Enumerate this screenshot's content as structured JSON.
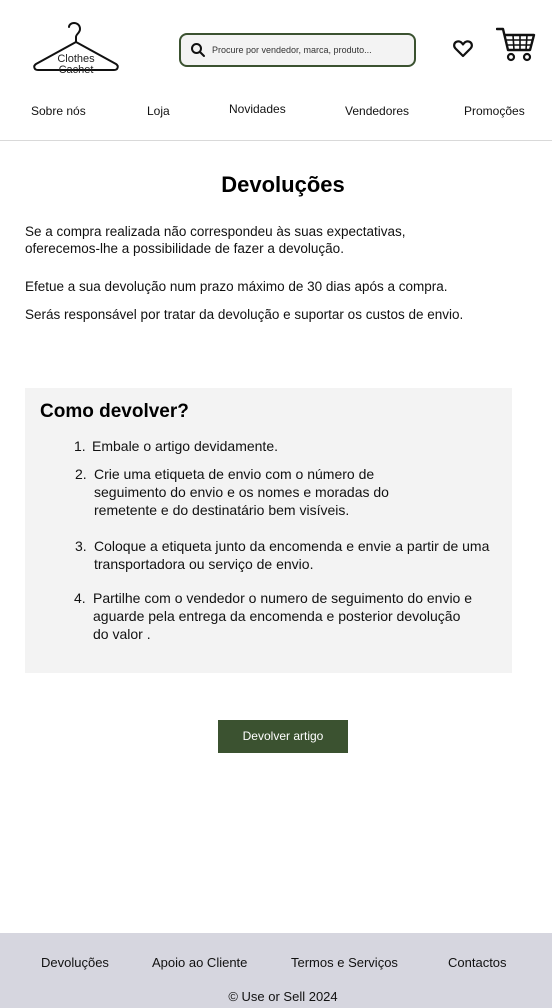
{
  "header": {
    "logo": {
      "line1": "Clothes",
      "line2": "Cachet",
      "icon": "hanger-icon"
    },
    "search": {
      "placeholder": "Procure por vendedor, marca, produto...",
      "value": ""
    },
    "icons": {
      "wishlist": "heart-icon",
      "cart": "cart-icon"
    }
  },
  "nav": {
    "items": [
      {
        "label": "Sobre nós"
      },
      {
        "label": "Loja"
      },
      {
        "label": "Novidades"
      },
      {
        "label": "Vendedores"
      },
      {
        "label": "Promoções"
      }
    ]
  },
  "main": {
    "title": "Devoluções",
    "intro": "Se a compra realizada não correspondeu às suas expectativas, oferecemos-lhe a possibilidade de fazer a devolução.",
    "deadline": "Efetue a sua devolução num prazo máximo de 30 dias após a compra.",
    "responsibility": "Serás responsável por tratar da devolução e suportar os custos de envio.",
    "howto": {
      "title": "Como devolver?",
      "steps": [
        {
          "num": "1.",
          "text": "Embale o artigo devidamente."
        },
        {
          "num": "2.",
          "text": "Crie uma etiqueta de envio com o número de seguimento do envio e os nomes e moradas do remetente e do destinatário bem visíveis."
        },
        {
          "num": "3.",
          "text": "Coloque a etiqueta junto da encomenda e envie a partir de uma transportadora ou serviço de envio."
        },
        {
          "num": "4.",
          "text": "Partilhe com o vendedor o numero de seguimento do envio e aguarde pela entrega da encomenda e posterior devolução do valor ."
        }
      ]
    },
    "button": "Devolver artigo"
  },
  "footer": {
    "links": [
      {
        "label": "Devoluções"
      },
      {
        "label": "Apoio ao Cliente"
      },
      {
        "label": "Termos e Serviços"
      },
      {
        "label": "Contactos"
      }
    ],
    "copyright": "© Use or Sell 2024"
  },
  "colors": {
    "accent": "#3b5230",
    "footer_bg": "#d6d6df",
    "box_bg": "#f3f3f3"
  }
}
